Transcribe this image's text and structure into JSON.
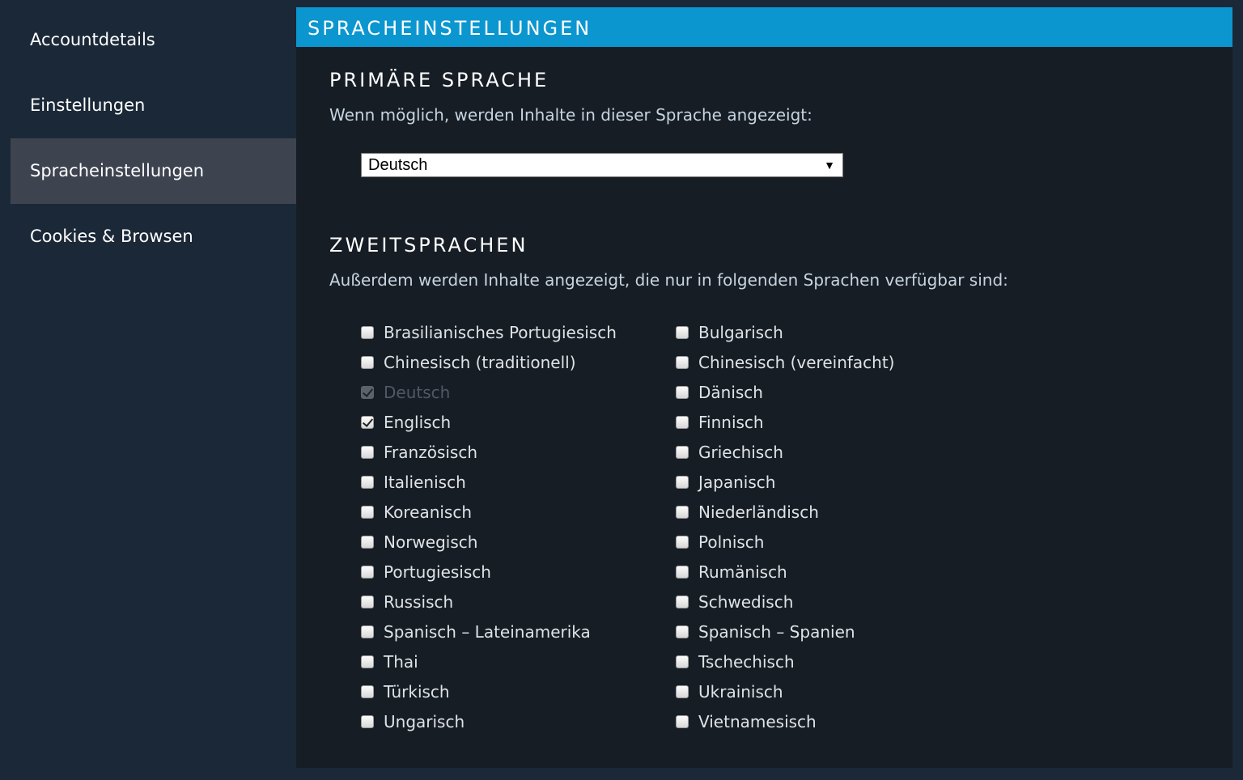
{
  "sidebar": {
    "items": [
      {
        "label": "Accountdetails",
        "active": false
      },
      {
        "label": "Einstellungen",
        "active": false
      },
      {
        "label": "Spracheinstellungen",
        "active": true
      },
      {
        "label": "Cookies & Browsen",
        "active": false
      }
    ]
  },
  "panel": {
    "title": "SPRACHEINSTELLUNGEN",
    "primary": {
      "title": "PRIMÄRE SPRACHE",
      "description": "Wenn möglich, werden Inhalte in dieser Sprache angezeigt:",
      "selected": "Deutsch"
    },
    "secondary": {
      "title": "ZWEITSPRACHEN",
      "description": "Außerdem werden Inhalte angezeigt, die nur in folgenden Sprachen verfügbar sind:",
      "left": [
        {
          "label": "Brasilianisches Portugiesisch",
          "checked": false,
          "disabled": false
        },
        {
          "label": "Chinesisch (traditionell)",
          "checked": false,
          "disabled": false
        },
        {
          "label": "Deutsch",
          "checked": true,
          "disabled": true
        },
        {
          "label": "Englisch",
          "checked": true,
          "disabled": false
        },
        {
          "label": "Französisch",
          "checked": false,
          "disabled": false
        },
        {
          "label": "Italienisch",
          "checked": false,
          "disabled": false
        },
        {
          "label": "Koreanisch",
          "checked": false,
          "disabled": false
        },
        {
          "label": "Norwegisch",
          "checked": false,
          "disabled": false
        },
        {
          "label": "Portugiesisch",
          "checked": false,
          "disabled": false
        },
        {
          "label": "Russisch",
          "checked": false,
          "disabled": false
        },
        {
          "label": "Spanisch – Lateinamerika",
          "checked": false,
          "disabled": false
        },
        {
          "label": "Thai",
          "checked": false,
          "disabled": false
        },
        {
          "label": "Türkisch",
          "checked": false,
          "disabled": false
        },
        {
          "label": "Ungarisch",
          "checked": false,
          "disabled": false
        }
      ],
      "right": [
        {
          "label": "Bulgarisch",
          "checked": false,
          "disabled": false
        },
        {
          "label": "Chinesisch (vereinfacht)",
          "checked": false,
          "disabled": false
        },
        {
          "label": "Dänisch",
          "checked": false,
          "disabled": false
        },
        {
          "label": "Finnisch",
          "checked": false,
          "disabled": false
        },
        {
          "label": "Griechisch",
          "checked": false,
          "disabled": false
        },
        {
          "label": "Japanisch",
          "checked": false,
          "disabled": false
        },
        {
          "label": "Niederländisch",
          "checked": false,
          "disabled": false
        },
        {
          "label": "Polnisch",
          "checked": false,
          "disabled": false
        },
        {
          "label": "Rumänisch",
          "checked": false,
          "disabled": false
        },
        {
          "label": "Schwedisch",
          "checked": false,
          "disabled": false
        },
        {
          "label": "Spanisch – Spanien",
          "checked": false,
          "disabled": false
        },
        {
          "label": "Tschechisch",
          "checked": false,
          "disabled": false
        },
        {
          "label": "Ukrainisch",
          "checked": false,
          "disabled": false
        },
        {
          "label": "Vietnamesisch",
          "checked": false,
          "disabled": false
        }
      ]
    }
  }
}
